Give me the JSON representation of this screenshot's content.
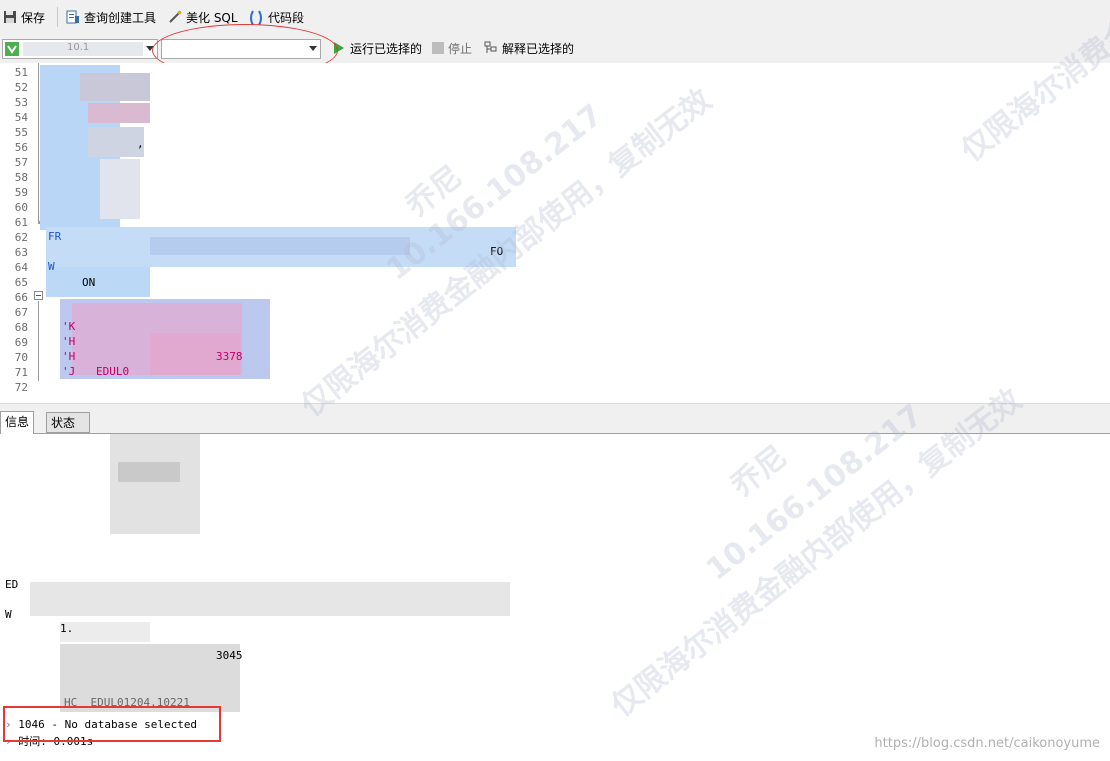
{
  "toolbar": {
    "save_label": "保存",
    "query_builder_label": "查询创建工具",
    "beautify_label": "美化 SQL",
    "snippet_label": "代码段"
  },
  "toolbar2": {
    "connection_text": "10.1",
    "database_text": "",
    "run_selected_label": "运行已选择的",
    "stop_label": "停止",
    "explain_selected_label": "解释已选择的"
  },
  "editor": {
    "line_numbers": [
      "51",
      "52",
      "53",
      "54",
      "55",
      "56",
      "57",
      "58",
      "59",
      "60",
      "61",
      "62",
      "63",
      "64",
      "65",
      "66",
      "67",
      "68",
      "69",
      "70",
      "71",
      "72"
    ],
    "visible_code": {
      "l56": ",",
      "l62": "FR",
      "l63": "FO",
      "l64": "W",
      "l65": "ON",
      "l67": "'K",
      "l68": "'H",
      "l69": "'H",
      "l70": "'J",
      "l70b": "3378",
      "l71": "EDUL0"
    }
  },
  "tabs": {
    "info": "信息",
    "status": "状态"
  },
  "output": {
    "line_fragment_1": "ED",
    "line_fragment_2": "W",
    "line_fragment_3": "1.",
    "line_fragment_4": "3045",
    "line_fragment_5": "HC  EDUL01204.10221",
    "error_line": "1046 - No database selected",
    "time_line": "时间: 0.001s"
  },
  "watermark": {
    "name": "乔尼",
    "ip": "10.166.108.217",
    "notice": "仅限海尔消费金融内部使用，复制无效"
  },
  "footer": {
    "blog_url": "https://blog.csdn.net/caikonoyume"
  },
  "colors": {
    "toolbar_bg": "#f0f0f0",
    "highlight_blue": "#a9cdf5",
    "error_red": "#e53935",
    "keyword_blue": "#0000ff",
    "string_pink": "#c0006b"
  }
}
